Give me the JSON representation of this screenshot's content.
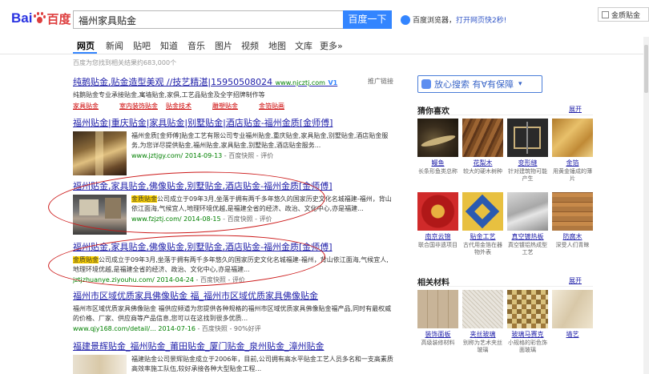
{
  "header": {
    "logo_left": "Bai",
    "logo_right": "百度",
    "search_query": "福州家具贴金",
    "search_button": "百度一下",
    "promo_text": "百度浏览器，",
    "promo_link": "打开网页快2秒!",
    "right_search_value": "金质贴金"
  },
  "nav": {
    "tabs": [
      "网页",
      "新闻",
      "贴吧",
      "知道",
      "音乐",
      "图片",
      "视频",
      "地图",
      "文库",
      "更多»"
    ]
  },
  "result_count": "百度为您找到相关结果约683,000个",
  "results": [
    {
      "title": "纯鹅贴金,贴金造型美观 //技艺精湛|15950508024",
      "url": "www.njcztj.com",
      "badge": "V1",
      "ad_label": "推广链接",
      "abstract": "纯鹅贴金专业承接贴金,寓墙贴金,家俱,工艺品贴金及全字招牌制作等",
      "sublinks": [
        "家具贴金",
        "室内装饰贴金",
        "贴金技术",
        "雕塑贴金",
        "金箔贴画"
      ]
    },
    {
      "title": "福州贴金|重庆贴金|家具贴金|别墅贴金|酒店贴金-福州金质[金师傅]",
      "body": "福州金质[金师傅]贴金工艺有限公司专业福州贴金,重庆贴金,家具贴金,别墅贴金,酒店贴金服务,为您详尽提供贴金,福州贴金,家具贴金,别墅贴金,酒店贴金服务...",
      "url": "www.jztjgy.com/ 2014-09-13",
      "snapshot": "百度快照",
      "review": "评价"
    },
    {
      "title": "福州贴金,家具贴金,佛像贴金,别墅贴金,酒店贴金-福州金质[金师傅]",
      "highlight": "金质贴金",
      "body": "公司成立于09年3月,坐落于拥有两千多年悠久的国家历史文化名城福建-福州，背山依江面海,气候宜人,地理环境优越,是福建全省的经济、政治、文化中心,亦是福建...",
      "url": "www.fzjztj.com/ 2014-08-15",
      "snapshot": "百度快照",
      "review": "评价"
    },
    {
      "title": "福州贴金,家具贴金,佛像贴金,别墅贴金,酒店贴金-福州金质[金师傅]",
      "highlight": "金质贴金",
      "body": "公司成立于09年3月,坐落于拥有两千多年悠久的国家历史文化名城福建-福州，背山依江面海,气候宜人,地理环境优越,是福建全省的经济、政治、文化中心,亦是福建...",
      "url": "jztjzhuanye.ziyouhu.com/ 2014-04-24",
      "snapshot": "百度快照",
      "review": "评价"
    },
    {
      "title": "福州市区域优质家具佛像贴金 福_福州市区域优质家具佛像贴金",
      "body": "福州市区域优质家具佛像贴金 福供应频道为您提供各种规格的福州市区域优质家具佛像贴金福产品,同时有最权威的价格、厂家、供应商等产品信息,您可以在这找到很多优质...",
      "url": "www.qjy168.com/detail/... 2014-07-16",
      "snapshot": "百度快照",
      "extra": "90%好评"
    },
    {
      "title": "福建景辉贴金_福州贴金_莆田贴金_厦门贴金_泉州贴金_漳州贴金",
      "body": "福建贴金公司景辉贴金成立于2006年，目前,公司拥有高水平贴金工艺人员多名和一支高素质高效率施工队伍,较好承接各种大型贴金工程..."
    }
  ],
  "right": {
    "trust_button": "放心搜索",
    "trust_tagline": "有∀有保障",
    "section1_title": "猜你喜欢",
    "section2_title": "相关材料",
    "expand_label": "展开",
    "cards_row1": [
      {
        "name": "鳗鱼",
        "desc": "长条形鱼类总称"
      },
      {
        "name": "花梨木",
        "desc": "较大的硬木树种"
      },
      {
        "name": "变形缝",
        "desc": "针对建筑物可能产生"
      },
      {
        "name": "金箔",
        "desc": "用黄金锤成的薄片"
      }
    ],
    "cards_row2": [
      {
        "name": "南京云锦",
        "desc": "联合国非遗项目"
      },
      {
        "name": "贴金工艺",
        "desc": "古代用金箔在器物外表"
      },
      {
        "name": "真空镀热板",
        "desc": "真空镀铝热成型工艺"
      },
      {
        "name": "防腐木",
        "desc": "深受人们青睐"
      }
    ],
    "cards_row3": [
      {
        "name": "装饰面板",
        "desc": "高级装修材料"
      },
      {
        "name": "夹丝玻璃",
        "desc": "别称为艺术夹丝玻璃"
      },
      {
        "name": "玻璃马赛克",
        "desc": "小规格的彩色饰面玻璃"
      },
      {
        "name": "墙艺",
        "desc": ""
      }
    ]
  },
  "colors": {
    "accent": "#3385ff",
    "title_link": "#2222aa",
    "keyword": "#cc0000",
    "url_green": "#008000",
    "annotation": "#cc1818"
  }
}
